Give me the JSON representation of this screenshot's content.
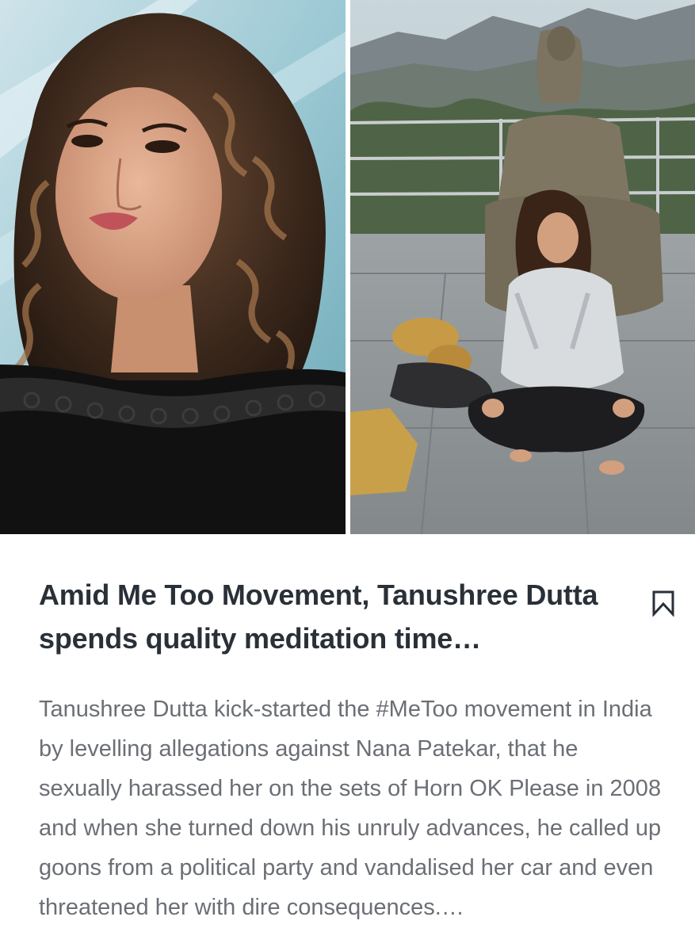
{
  "article": {
    "headline": "Amid Me Too Movement, Tanushree Dutta spends quality meditation time…",
    "summary": "Tanushree Dutta kick-started the #MeToo movement in India by levelling allegations against Nana Patekar, that he sexually harassed her on the sets of Horn OK Please in 2008 and when she turned down his unruly advances, he called up goons from a political party and vandalised her car and even threatened her with dire consequences.…"
  },
  "icons": {
    "bookmark": "bookmark-icon"
  },
  "colors": {
    "headline": "#2a3038",
    "summary": "#6b6f75",
    "icon": "#2a3038"
  }
}
